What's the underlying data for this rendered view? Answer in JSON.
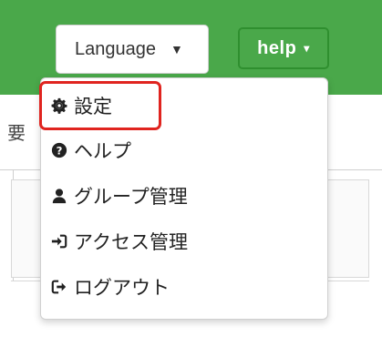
{
  "header": {
    "language_select": {
      "label": "Language",
      "caret": "▼"
    },
    "help_button": {
      "label": "help",
      "caret": "▾"
    }
  },
  "page": {
    "partial_label": "要"
  },
  "dropdown": {
    "items": [
      {
        "label": "設定",
        "icon": "gear-icon"
      },
      {
        "label": "ヘルプ",
        "icon": "question-circle-icon"
      },
      {
        "label": "グループ管理",
        "icon": "user-icon"
      },
      {
        "label": "アクセス管理",
        "icon": "sign-in-icon"
      },
      {
        "label": "ログアウト",
        "icon": "sign-out-icon"
      }
    ]
  },
  "colors": {
    "header_green": "#4aa84a",
    "highlight_red": "#e0241f"
  }
}
